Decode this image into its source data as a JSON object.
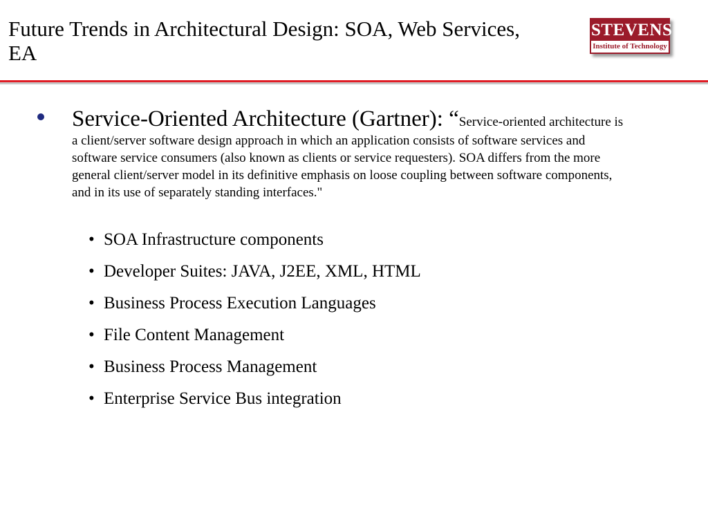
{
  "title": "Future Trends in Architectural Design: SOA, Web Services, EA",
  "logo": {
    "name": "STEVENS",
    "subtitle": "Institute of Technology"
  },
  "colors": {
    "divider": "#e01b24",
    "logo": "#9b1b2a",
    "bullet": "#1f2a80"
  },
  "content": {
    "heading": "Service-Oriented Architecture (Gartner): “",
    "quote": "Service-oriented architecture is a client/server software design approach in which an application consists of software services and software service consumers (also known as clients or service requesters). SOA differs from the more general client/server model in its definitive emphasis on loose coupling between software components, and in its use of separately standing interfaces.\"",
    "bullet_icon": "filled-circle",
    "sub_bullet_glyph": "•",
    "sub_items": [
      "SOA Infrastructure components",
      "Developer Suites: JAVA, J2EE, XML, HTML",
      "Business Process Execution Languages",
      "File Content Management",
      "Business Process Management",
      "Enterprise Service Bus integration"
    ]
  }
}
